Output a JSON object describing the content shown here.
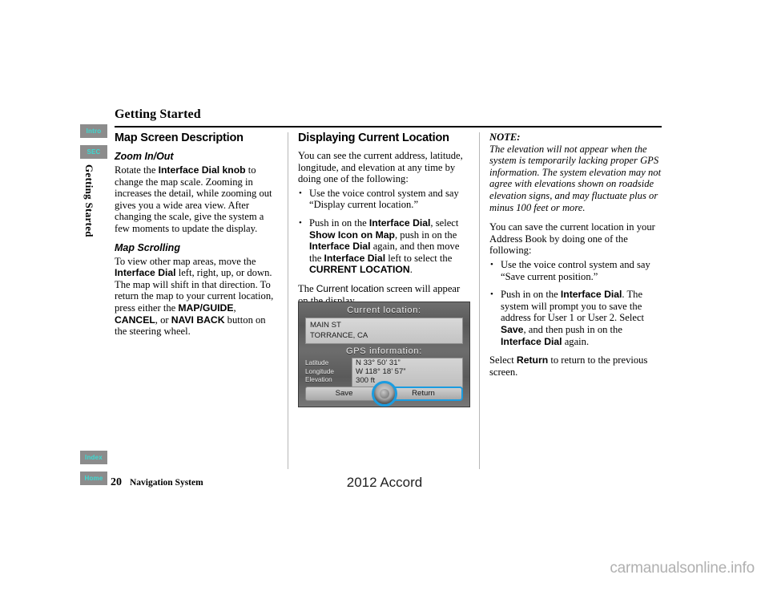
{
  "chapter": {
    "title": "Getting Started",
    "side_label": "Getting Started"
  },
  "tabs": {
    "top": [
      {
        "name": "intro",
        "label": "Intro"
      },
      {
        "name": "sec",
        "label": "SEC"
      }
    ],
    "bottom": [
      {
        "name": "index",
        "label": "Index"
      },
      {
        "name": "home",
        "label": "Home"
      }
    ],
    "bg_color": "#8c8c8c",
    "text_color": "#3bdbd3"
  },
  "columns": {
    "left": {
      "heading": "Map Screen Description",
      "sections": [
        {
          "subhead": "Zoom In/Out",
          "paragraph_pre": "Rotate the ",
          "paragraph_bold": "Interface Dial knob",
          "paragraph_post": " to change the map scale. Zooming in increases the detail, while zooming out gives you a wide area view. After changing the scale, give the system a few moments to update the display."
        },
        {
          "subhead": "Map Scrolling",
          "p_a": "To view other map areas, move the ",
          "p_a_bold": "Interface Dial",
          "p_b": " left, right, up, or down. The map will shift in that direction. To return the map to your current location, press either the ",
          "p_b_bold1": "MAP/GUIDE",
          "p_c": ", ",
          "p_b_bold2": "CANCEL",
          "p_d": ", or ",
          "p_b_bold3": "NAVI BACK",
          "p_e": " button on the steering wheel."
        }
      ]
    },
    "middle": {
      "heading": "Displaying Current Location",
      "intro": "You can see the current address, latitude, longitude, and elevation at any time by doing one of the following:",
      "bullets": [
        {
          "pre": "Use the voice control system and say “Display current location.”"
        },
        {
          "pre": "Push in on the ",
          "b1": "Interface Dial",
          "mid1": ", select ",
          "b2": "Show Icon on Map",
          "mid2": ", push in on the ",
          "b3": "Interface Dial",
          "mid3": " again, and then move the ",
          "b4": "Interface Dial",
          "mid4": " left to select the ",
          "b5": "CURRENT LOCATION",
          "post": "."
        }
      ],
      "caption_pre": "The ",
      "caption_mid": "Current location",
      "caption_post": " screen will appear on the display."
    },
    "right": {
      "note_title": "NOTE:",
      "note_body": "The elevation will not appear when the system is temporarily lacking proper GPS information. The system elevation may not agree with elevations shown on roadside elevation signs, and may fluctuate plus or minus 100 feet or more.",
      "save_intro": "You can save the current location in your Address Book by doing one of the following:",
      "bullets": [
        {
          "pre": "Use the voice control system and say “Save current position.”"
        },
        {
          "pre": "Push in on the ",
          "b1": "Interface Dial",
          "mid1": ". The system will prompt you to save the address for User 1 or User 2. Select ",
          "b2": "Save",
          "mid2": ", and then push in on the ",
          "b3": "Interface Dial",
          "post": " again."
        }
      ],
      "closing_pre": "Select ",
      "closing_bold": "Return",
      "closing_post": " to return to the previous screen."
    }
  },
  "nav_screen": {
    "header": "Current location:",
    "address_line1": "MAIN ST",
    "address_line2": "TORRANCE, CA",
    "gps_header": "GPS information:",
    "gps_labels": [
      "Latitude",
      "Longitude",
      "Elevation"
    ],
    "gps_values": [
      "N 33° 50’ 31”",
      "W 118° 18’ 57”",
      "300 ft"
    ],
    "button_save": "Save",
    "button_return": "Return",
    "highlight_color": "#1b9ce0"
  },
  "footer": {
    "page_number": "20",
    "manual_name": "Navigation System",
    "model": "2012 Accord",
    "watermark": "carmanualsonline.info"
  }
}
